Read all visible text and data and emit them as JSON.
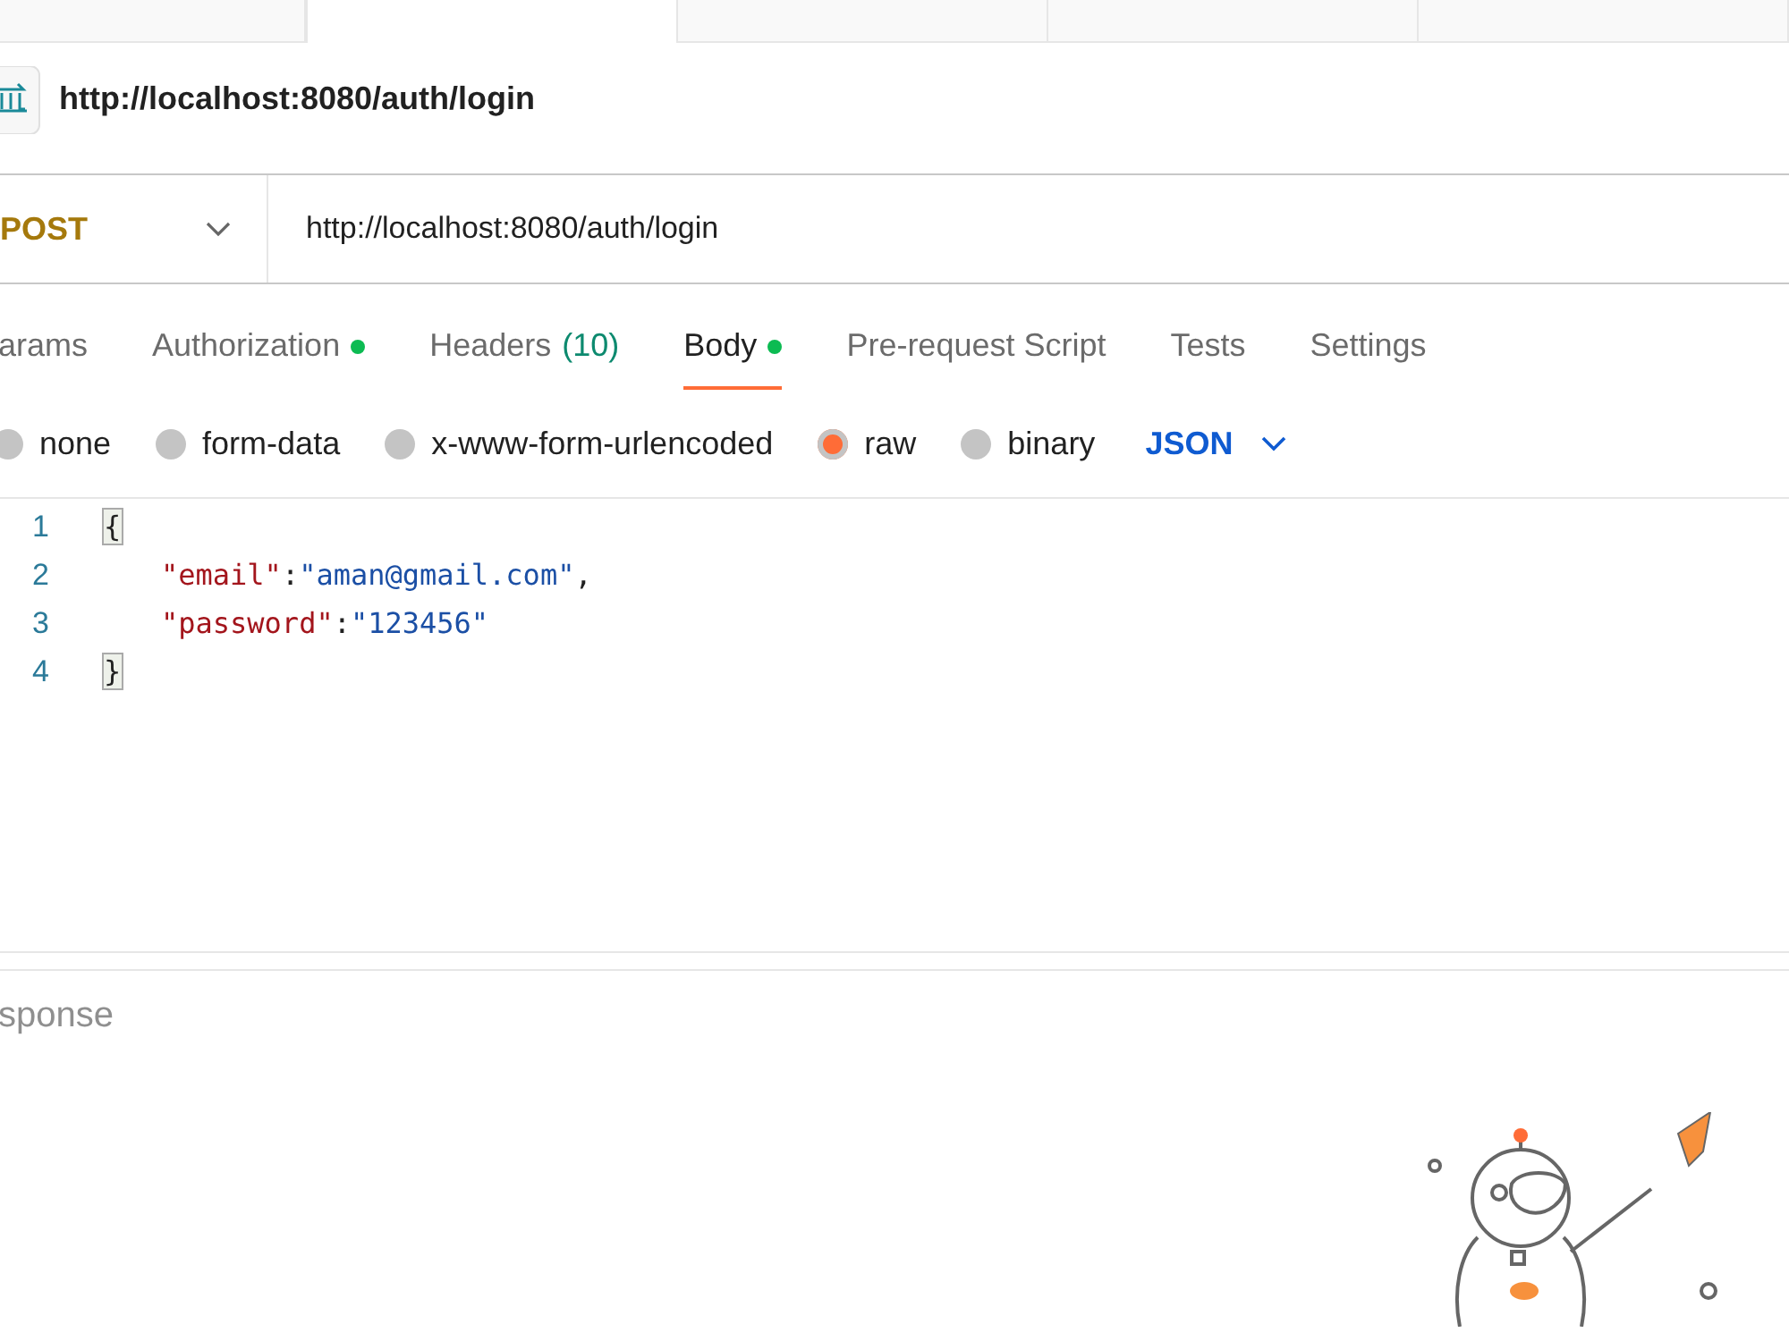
{
  "request_tabs": [
    {
      "selected": false
    },
    {
      "selected": true
    },
    {
      "selected": false
    },
    {
      "selected": false
    },
    {
      "selected": false
    }
  ],
  "header": {
    "title": "http://localhost:8080/auth/login"
  },
  "request": {
    "method": "POST",
    "url": "http://localhost:8080/auth/login"
  },
  "tabs": [
    {
      "label": "arams",
      "selected": false,
      "dot": false
    },
    {
      "label": "Authorization",
      "selected": false,
      "dot": true
    },
    {
      "label": "Headers",
      "count": "(10)",
      "selected": false,
      "dot": false
    },
    {
      "label": "Body",
      "selected": true,
      "dot": true
    },
    {
      "label": "Pre-request Script",
      "selected": false,
      "dot": false
    },
    {
      "label": "Tests",
      "selected": false,
      "dot": false
    },
    {
      "label": "Settings",
      "selected": false,
      "dot": false
    }
  ],
  "body_types": [
    {
      "label": "none",
      "selected": false
    },
    {
      "label": "form-data",
      "selected": false
    },
    {
      "label": "x-www-form-urlencoded",
      "selected": false
    },
    {
      "label": "raw",
      "selected": true
    },
    {
      "label": "binary",
      "selected": false
    }
  ],
  "format": "JSON",
  "editor": {
    "lines": [
      {
        "number": "1",
        "kind": "brace",
        "tokens": [
          {
            "kind": "brace",
            "text": "{"
          }
        ]
      },
      {
        "number": "2",
        "kind": "member",
        "tokens": [
          {
            "kind": "key",
            "text": "\"email\""
          },
          {
            "kind": "punct",
            "text": ":"
          },
          {
            "kind": "string",
            "text": "\"aman@gmail.com\""
          },
          {
            "kind": "punct",
            "text": ","
          }
        ]
      },
      {
        "number": "3",
        "kind": "member",
        "tokens": [
          {
            "kind": "key",
            "text": "\"password\""
          },
          {
            "kind": "punct",
            "text": ":"
          },
          {
            "kind": "string",
            "text": "\"123456\""
          }
        ]
      },
      {
        "number": "4",
        "kind": "brace",
        "tokens": [
          {
            "kind": "brace",
            "text": "}"
          }
        ]
      }
    ]
  },
  "response": {
    "title": "sponse"
  }
}
